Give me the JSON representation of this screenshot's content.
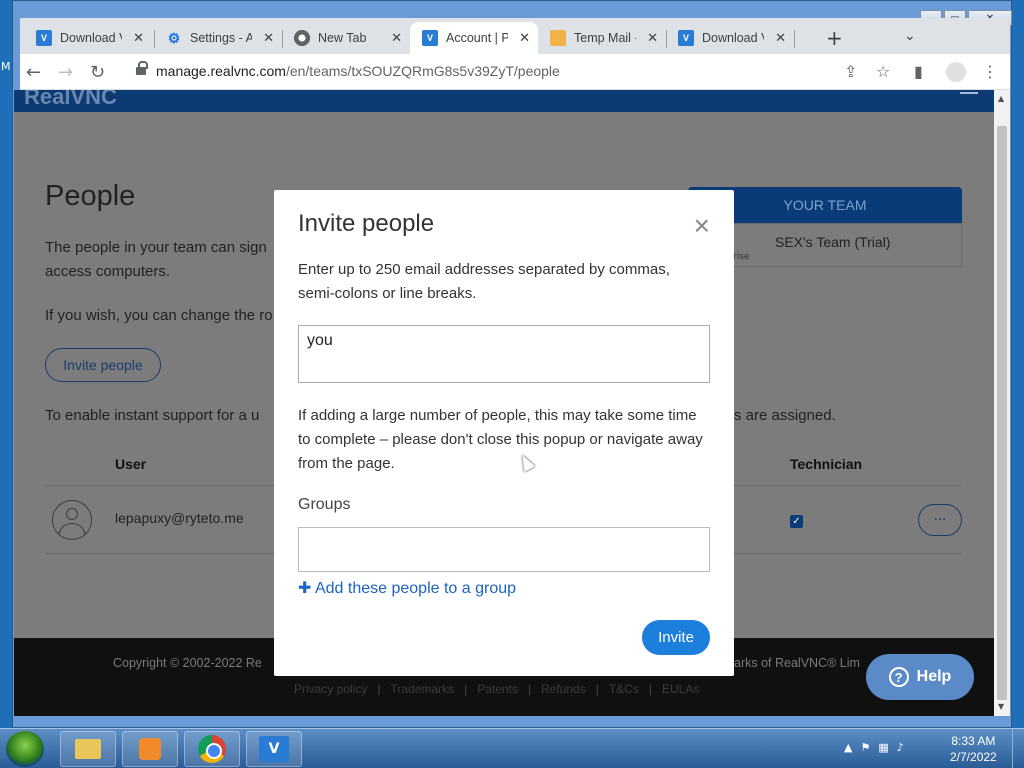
{
  "desktop": {
    "edge_text": "M"
  },
  "browser": {
    "tabs": [
      {
        "label": "Download V",
        "icon": "vnc-icon"
      },
      {
        "label": "Settings - A",
        "icon": "gear-icon"
      },
      {
        "label": "New Tab",
        "icon": "chrome-icon"
      },
      {
        "label": "Account | Pe",
        "icon": "vnc-icon",
        "active": true
      },
      {
        "label": "Temp Mail -",
        "icon": "mail-icon"
      },
      {
        "label": "Download V",
        "icon": "vnc-icon"
      }
    ],
    "new_tab": "+",
    "url_host": "manage.realvnc.com",
    "url_path": "/en/teams/txSOUZQRmG8s5v39ZyT/people",
    "window_buttons": {
      "minimize": "—",
      "maximize": "▭",
      "close": "✕"
    }
  },
  "page": {
    "logo": "RealVNC",
    "title": "People",
    "intro_line1": "The people in your team can sign",
    "intro_line2": "access computers.",
    "change_text": "If you wish, you can change the ro",
    "invite_outline_label": "Invite people",
    "support_text_left": "To enable instant support for a u",
    "support_text_right": "s are assigned.",
    "columns": {
      "user": "User",
      "technician": "Technician"
    },
    "users": [
      {
        "email": "lepapuxy@ryteto.me",
        "technician": true
      }
    ],
    "more_label": "···",
    "team_card": {
      "header": "YOUR TEAM",
      "name": "SEX's Team (Trial)",
      "partial_label": "rise"
    },
    "footer": {
      "copyright": "Copyright © 2002-2022 Re",
      "trademarks_text": "arks of RealVNC® Lim",
      "links": [
        "Privacy policy",
        "Trademarks",
        "Patents",
        "Refunds",
        "T&Cs",
        "EULAs"
      ]
    },
    "help_label": "Help"
  },
  "modal": {
    "title": "Invite people",
    "close": "×",
    "description": "Enter up to 250 email addresses separated by commas, semi-colons or line breaks.",
    "email_value": "you",
    "note": "If adding a large number of people, this may take some time to complete – please don't close this popup or navigate away from the page.",
    "groups_label": "Groups",
    "groups_value": "",
    "add_group_link": "Add these people to a group",
    "invite_button": "Invite"
  },
  "taskbar": {
    "clock_time": "8:33 AM",
    "clock_date": "2/7/2022"
  },
  "colors": {
    "modal_button": "#1c7fdc",
    "link": "#1c64c0",
    "overlay": "#7b7b7b",
    "team_header": "#0a3a78"
  }
}
